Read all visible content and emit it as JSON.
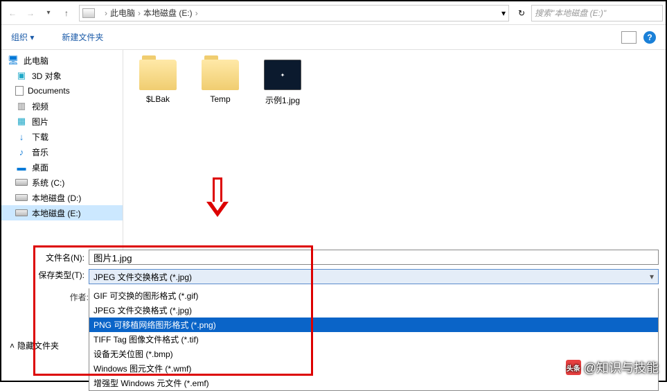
{
  "nav": {
    "path_root": "此电脑",
    "path_drive": "本地磁盘 (E:)",
    "search_placeholder": "搜索\"本地磁盘 (E:)\""
  },
  "toolbar": {
    "organize": "组织 ▾",
    "new_folder": "新建文件夹"
  },
  "sidebar": {
    "root": "此电脑",
    "items": [
      "3D 对象",
      "Documents",
      "视频",
      "图片",
      "下载",
      "音乐",
      "桌面",
      "系统 (C:)",
      "本地磁盘 (D:)",
      "本地磁盘 (E:)"
    ]
  },
  "files": [
    {
      "name": "$LBak",
      "type": "folder"
    },
    {
      "name": "Temp",
      "type": "folder"
    },
    {
      "name": "示例1.jpg",
      "type": "image"
    }
  ],
  "form": {
    "filename_label": "文件名(N):",
    "filename_value": "图片1.jpg",
    "type_label": "保存类型(T):",
    "type_selected": "JPEG 文件交换格式 (*.jpg)",
    "author_label": "作者:",
    "hide_folders": "隐藏文件夹",
    "options": [
      "GIF 可交换的图形格式 (*.gif)",
      "JPEG 文件交换格式 (*.jpg)",
      "PNG 可移植网络图形格式 (*.png)",
      "TIFF Tag 图像文件格式 (*.tif)",
      "设备无关位图 (*.bmp)",
      "Windows 图元文件 (*.wmf)",
      "增强型 Windows 元文件 (*.emf)"
    ],
    "highlighted_index": 2
  },
  "watermark": {
    "logo_text": "头条",
    "text": "@知识与技能"
  }
}
